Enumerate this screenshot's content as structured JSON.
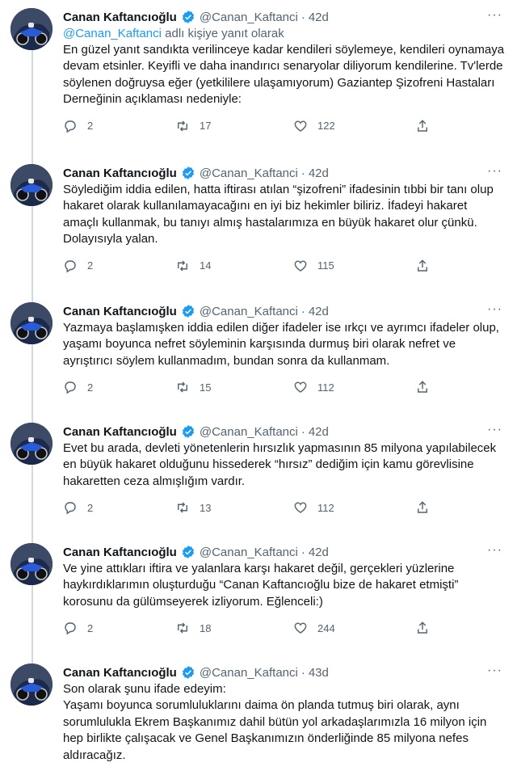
{
  "tweets": [
    {
      "name": "Canan Kaftancıoğlu",
      "handle": "@Canan_Kaftanci",
      "time": "42d",
      "reply_to_handle": "@Canan_Kaftanci",
      "reply_to_suffix": " adlı kişiye yanıt olarak",
      "text": "En güzel yanıt sandıkta verilinceye kadar kendileri söylemeye, kendileri oynamaya devam etsinler. Keyifli ve daha inandırıcı senaryolar diliyorum kendilerine. Tv'lerde söylenen doğruysa eğer (yetkililere ulaşamıyorum) Gaziantep Şizofreni Hastaları Derneğinin açıklaması nedeniyle:",
      "replies": "2",
      "retweets": "17",
      "likes": "122"
    },
    {
      "name": "Canan Kaftancıoğlu",
      "handle": "@Canan_Kaftanci",
      "time": "42d",
      "text": "Söylediğim iddia edilen, hatta iftirası atılan “şizofreni” ifadesinin tıbbi bir tanı olup hakaret olarak kullanılamayacağını en iyi biz hekimler biliriz. İfadeyi hakaret amaçlı kullanmak, bu tanıyı almış hastalarımıza en büyük hakaret olur çünkü. Dolayısıyla yalan.",
      "replies": "2",
      "retweets": "14",
      "likes": "115"
    },
    {
      "name": "Canan Kaftancıoğlu",
      "handle": "@Canan_Kaftanci",
      "time": "42d",
      "text": "Yazmaya başlamışken iddia edilen diğer ifadeler ise ırkçı ve ayrımcı ifadeler olup, yaşamı boyunca nefret söyleminin karşısında durmuş biri olarak nefret ve ayrıştırıcı söylem kullanmadım, bundan sonra da kullanmam.",
      "replies": "2",
      "retweets": "15",
      "likes": "112"
    },
    {
      "name": "Canan Kaftancıoğlu",
      "handle": "@Canan_Kaftanci",
      "time": "42d",
      "text": "Evet bu arada, devleti yönetenlerin hırsızlık yapmasının 85 milyona yapılabilecek en büyük hakaret olduğunu hissederek “hırsız” dediğim için kamu görevlisine hakaretten ceza almışlığım vardır.",
      "replies": "2",
      "retweets": "13",
      "likes": "112"
    },
    {
      "name": "Canan Kaftancıoğlu",
      "handle": "@Canan_Kaftanci",
      "time": "42d",
      "text": "Ve yine attıkları iftira ve yalanlara karşı hakaret değil, gerçekleri yüzlerine haykırdıklarımın oluşturduğu “Canan Kaftancıoğlu bize de hakaret etmişti” korosunu da gülümseyerek izliyorum. Eğlenceli:)",
      "replies": "2",
      "retweets": "18",
      "likes": "244"
    },
    {
      "name": "Canan Kaftancıoğlu",
      "handle": "@Canan_Kaftanci",
      "time": "43d",
      "text_line1": "Son olarak şunu ifade edeyim:",
      "text": "Yaşamı boyunca sorumluluklarını daima ön planda tutmuş biri olarak, aynı sorumlulukla Ekrem Başkanımız dahil bütün yol arkadaşlarımızla 16 milyon için hep birlikte çalışacak ve Genel Başkanımızın önderliğinde 85 milyona nefes aldıracağız."
    }
  ],
  "dot": "·",
  "more_glyph": "···",
  "colors": {
    "accent": "#1d9bf0",
    "secondary": "#536471",
    "text": "#0f1419",
    "line": "#cfd9de"
  }
}
